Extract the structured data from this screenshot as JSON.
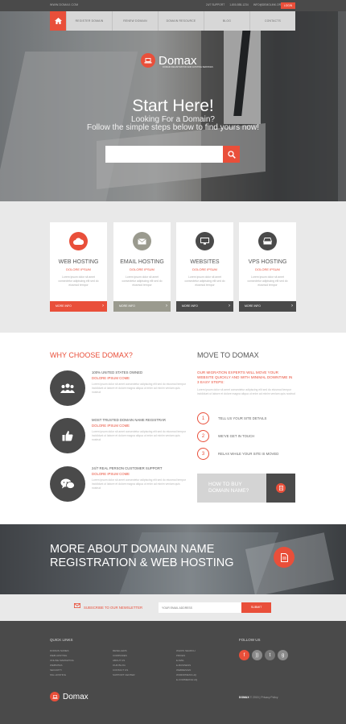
{
  "topbar": {
    "url": "WWW.DOMAX.COM",
    "links": [
      "24/7 SUPPORT",
      "1-800-555-1234",
      "INFO@DEMOLINK.ORG"
    ],
    "login_label": "LOGIN"
  },
  "nav": {
    "items": [
      "REGISTER DOMAIN",
      "RENEW DOMAIN",
      "DOMAIN RESOURCE",
      "BLOG",
      "CONTACTS"
    ]
  },
  "brand": {
    "name": "Domax",
    "tagline": "DOMAIN REGISTRATION AND HOSTING SERVICES"
  },
  "hero": {
    "title": "Start Here!",
    "subtitle_1": "Looking For a Domain?",
    "subtitle_2": "Follow the simple steps below to find yours now!",
    "search_placeholder": ""
  },
  "services": [
    {
      "title": "WEB HOSTING",
      "subtitle": "DOLORE IPSUM",
      "desc": "Lorem ipsum dolor sit amet consectetur adipiscing elit sed do eiusmod tempor",
      "more": "MORE INFO",
      "icon": "cloud-icon",
      "color": "#e94f3a"
    },
    {
      "title": "EMAIL HOSTING",
      "subtitle": "DOLORE IPSUM",
      "desc": "Lorem ipsum dolor sit amet consectetur adipiscing elit sed do eiusmod tempor",
      "more": "MORE INFO",
      "icon": "envelope-icon",
      "color": "#9a9a8e"
    },
    {
      "title": "WEBSITES",
      "subtitle": "DOLORE IPSUM",
      "desc": "Lorem ipsum dolor sit amet consectetur adipiscing elit sed do eiusmod tempor",
      "more": "MORE INFO",
      "icon": "monitor-icon",
      "color": "#4a4a4a"
    },
    {
      "title": "VPS HOSTING",
      "subtitle": "DOLORE IPSUM",
      "desc": "Lorem ipsum dolor sit amet consectetur adipiscing elit sed do eiusmod tempor",
      "more": "MORE INFO",
      "icon": "server-icon",
      "color": "#4a4a4a"
    }
  ],
  "why": {
    "title": "WHY CHOOSE DOMAX?",
    "features": [
      {
        "heading": "100% UNITED STATES OWNED",
        "sub": "DOLORE IPSUM COME",
        "desc": "Lorem ipsum dolor sit amet consectetur adipiscing elit sed do eiusmod tempor incididunt ut labore et dolore magna aliqua ut enim ad minim veniam quis nostrud",
        "icon": "users-icon"
      },
      {
        "heading": "MOST TRUSTED DOMAIN NAME REGISTRAR",
        "sub": "DOLORE IPSUM COME",
        "desc": "Lorem ipsum dolor sit amet consectetur adipiscing elit sed do eiusmod tempor incididunt ut labore et dolore magna aliqua ut enim ad minim veniam quis nostrud",
        "icon": "thumbs-up-icon"
      },
      {
        "heading": "24/7 REAL PERSON CUSTOMER SUPPORT",
        "sub": "DOLORE IPSUM COME",
        "desc": "Lorem ipsum dolor sit amet consectetur adipiscing elit sed do eiusmod tempor incididunt ut labore et dolore magna aliqua ut enim ad minim veniam quis nostrud",
        "icon": "chat-icon"
      }
    ]
  },
  "move": {
    "title": "MOVE TO DOMAX",
    "intro": "OUR MIGRATION EXPERTS WILL MOVE YOUR WEBSITE QUICKLY AND WITH MINIMAL DOWNTIME IN 3 EASY STEPS:",
    "desc": "Lorem ipsum dolor sit amet consectetur adipiscing elit sed do eiusmod tempor incididunt ut labore et dolore magna aliqua ut enim ad minim veniam quis nostrud",
    "steps": [
      {
        "num": "1",
        "label": "TELL US YOUR SITE DETAILS"
      },
      {
        "num": "2",
        "label": "WE'VE GET IN TOUCH"
      },
      {
        "num": "3",
        "label": "RELAX WHILE YOUR SITE IS MOVED"
      }
    ],
    "buy_label_1": "HOW TO BUY",
    "buy_label_2": "DOMAIN NAME?"
  },
  "banner": {
    "line_1": "MORE ABOUT DOMAIN NAME",
    "line_2": "REGISTRATION & WEB HOSTING"
  },
  "newsletter": {
    "label": "SUBSCRIBE TO OUR NEWSLETTER",
    "placeholder": "YOUR EMAIL ADDRESS",
    "submit": "SUBMIT"
  },
  "footer": {
    "quick_links_title": "QUICK LINKS",
    "follow_title": "FOLLOW US",
    "col_1": [
      "DOMAIN NAMES",
      "WEB HOSTING",
      "ONLINE MARKETING",
      "WEBSITES",
      "SECURITY",
      "SSL HOSTING"
    ],
    "col_2": [
      "RESELLERS",
      "COMPANIES",
      "ABOUT US",
      "OUR BLOG",
      "CONTACT US",
      "SUPPORT CENTER"
    ],
    "col_3": [
      "WHOIS SEARCH",
      "PRICES",
      "E-MAIL",
      "E-BUSINESS",
      "WEBDESIGN",
      "WORDPRESS HQ",
      "E-COMMERCE HQ"
    ],
    "copyright_brand": "DOMAX",
    "copyright_rest": "© 2015 | Privacy Policy"
  },
  "colors": {
    "accent": "#e94f3a",
    "dark": "#4a4a4a",
    "light": "#e9e9e9"
  }
}
